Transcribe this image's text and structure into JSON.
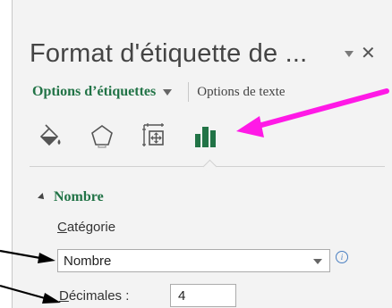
{
  "pane": {
    "title": "Format d'étiquette de ...",
    "controls": {
      "dropdown_icon": "chevron-down-icon",
      "close_glyph": "✕"
    }
  },
  "tabs": {
    "active": "Options d’étiquettes",
    "inactive": "Options de texte"
  },
  "icons": [
    {
      "name": "fill-line-icon"
    },
    {
      "name": "effects-icon"
    },
    {
      "name": "size-properties-icon"
    },
    {
      "name": "label-options-icon",
      "selected": true
    }
  ],
  "section": {
    "title": "Nombre",
    "category_label_first": "C",
    "category_label_rest": "atégorie",
    "category_value": "Nombre",
    "info_glyph": "i",
    "decimals_label_first": "D",
    "decimals_label_rest": "écimales :",
    "decimals_value": "4"
  },
  "colors": {
    "accent_green": "#217346",
    "annotation_magenta": "#ff19e6",
    "annotation_black": "#000000"
  }
}
